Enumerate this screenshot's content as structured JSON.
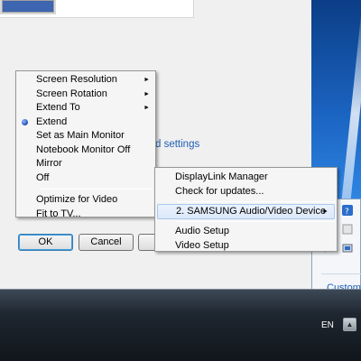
{
  "dialog": {
    "link_text": "d settings",
    "buttons": {
      "ok": "OK",
      "cancel": "Cancel"
    }
  },
  "main_menu": {
    "items": [
      {
        "label": "Screen Resolution",
        "submenu": true
      },
      {
        "label": "Screen Rotation",
        "submenu": true
      },
      {
        "label": "Extend To",
        "submenu": true
      },
      {
        "label": "Extend",
        "selected": true
      },
      {
        "label": "Set as Main Monitor"
      },
      {
        "label": "Notebook Monitor Off"
      },
      {
        "label": "Mirror"
      },
      {
        "label": "Off"
      },
      {
        "label": "Optimize for Video"
      },
      {
        "label": "Fit to TV..."
      }
    ]
  },
  "sub_menu": {
    "items": [
      {
        "label": "DisplayLink Manager"
      },
      {
        "label": "Check for updates..."
      },
      {
        "label": "2. SAMSUNG Audio/Video Device",
        "submenu": true,
        "highlighted": true
      },
      {
        "label": "Audio Setup"
      },
      {
        "label": "Video Setup"
      }
    ]
  },
  "tray_flyout": {
    "customize_label": "Customize"
  },
  "taskbar": {
    "language": "EN",
    "show_hidden_glyph": "▲"
  },
  "icons": {
    "submenu_arrow": "►"
  },
  "colors": {
    "link": "#1e5fb4",
    "taskbar": "#1e2630",
    "desktop": "#1b64c2"
  }
}
